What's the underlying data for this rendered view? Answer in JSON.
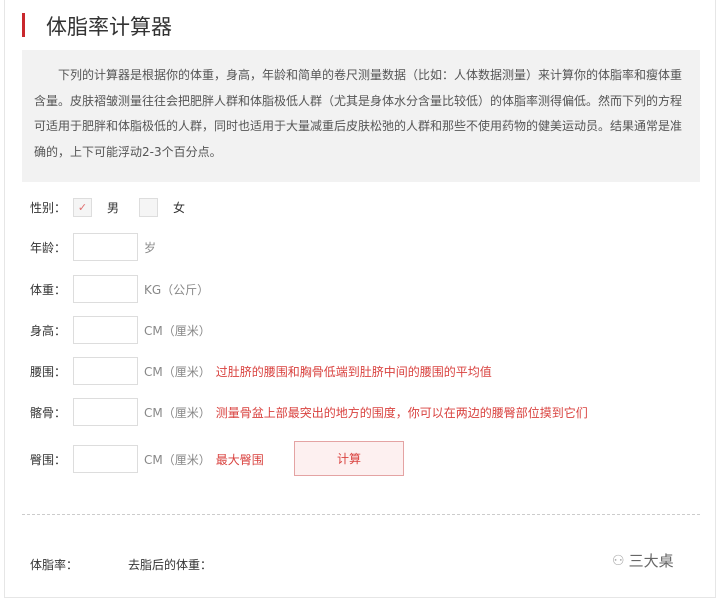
{
  "title": "体脂率计算器",
  "intro": "下列的计算器是根据你的体重，身高，年龄和简单的卷尺测量数据（比如：人体数据测量）来计算你的体脂率和瘦体重含量。皮肤褶皱测量往往会把肥胖人群和体脂极低人群（尤其是身体水分含量比较低）的体脂率测得偏低。然而下列的方程可适用于肥胖和体脂极低的人群，同时也适用于大量减重后皮肤松弛的人群和那些不使用药物的健美运动员。结果通常是准确的，上下可能浮动2-3个百分点。",
  "gender": {
    "label": "性别：",
    "male": "男",
    "female": "女",
    "selected": "男"
  },
  "fields": [
    {
      "label": "年龄：",
      "value": "",
      "unit": "岁",
      "note": ""
    },
    {
      "label": "体重：",
      "value": "",
      "unit": "KG（公斤）",
      "note": ""
    },
    {
      "label": "身高：",
      "value": "",
      "unit": "CM（厘米）",
      "note": ""
    },
    {
      "label": "腰围：",
      "value": "",
      "unit": "CM（厘米）",
      "note": "过肚脐的腰围和胸骨低端到肚脐中间的腰围的平均值"
    },
    {
      "label": "髂骨：",
      "value": "",
      "unit": "CM（厘米）",
      "note": "测量骨盆上部最突出的地方的围度，你可以在两边的腰臀部位摸到它们"
    },
    {
      "label": "臀围：",
      "value": "",
      "unit": "CM（厘米）",
      "note": "最大臀围"
    }
  ],
  "calc_button": "计算",
  "results": {
    "bodyfat_label": "体脂率：",
    "lean_label": "去脂后的体重："
  },
  "watermark": "三大桌"
}
